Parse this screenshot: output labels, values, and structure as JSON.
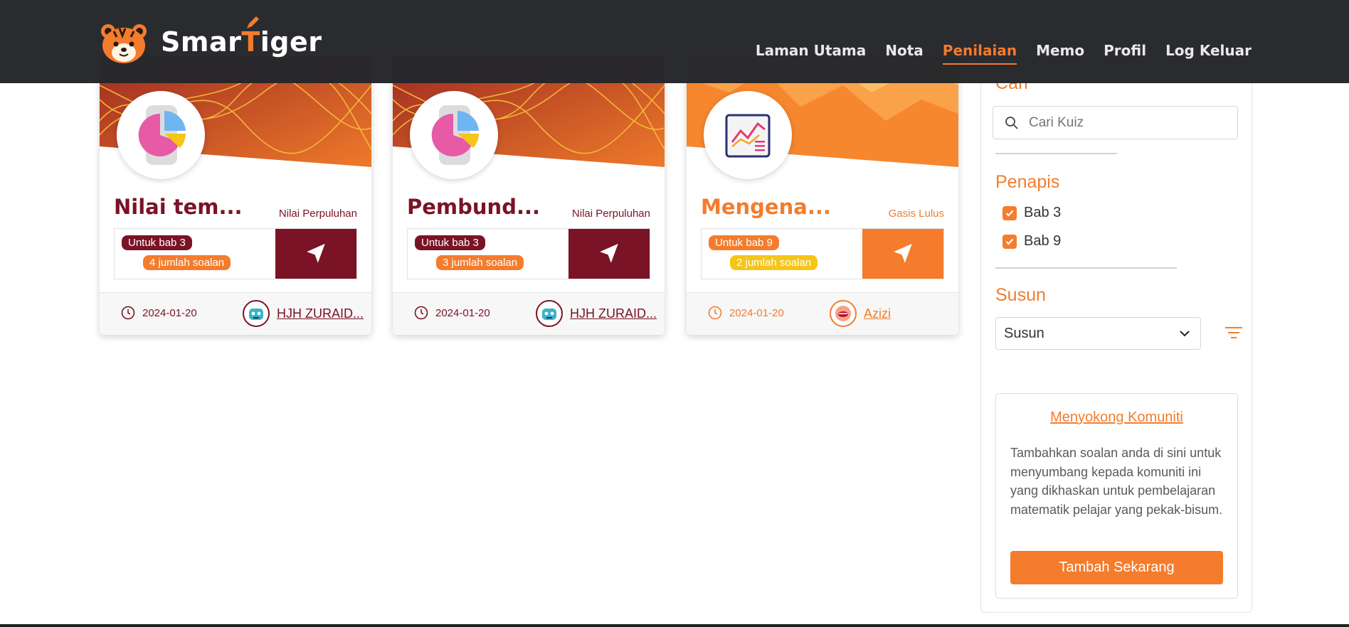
{
  "brand": {
    "name_part1": "Smar",
    "name_t": "T",
    "name_part2": "iger"
  },
  "nav": [
    {
      "label": "Laman Utama",
      "active": false
    },
    {
      "label": "Nota",
      "active": false
    },
    {
      "label": "Penilaian",
      "active": true
    },
    {
      "label": "Memo",
      "active": false
    },
    {
      "label": "Profil",
      "active": false
    },
    {
      "label": "Log Keluar",
      "active": false
    }
  ],
  "cards": [
    {
      "title": "Nilai tem...",
      "type": "Nilai Perpuluhan",
      "chapter": "Untuk bab 3",
      "count": "4 jumlah soalan",
      "date": "2024-01-20",
      "author": "HJH ZURAID...",
      "theme": "maroon",
      "icon": "pie-chart-icon"
    },
    {
      "title": "Pembund...",
      "type": "Nilai Perpuluhan",
      "chapter": "Untuk bab 3",
      "count": "3 jumlah soalan",
      "date": "2024-01-20",
      "author": "HJH ZURAID...",
      "theme": "maroon",
      "icon": "pie-chart-icon"
    },
    {
      "title": "Mengena...",
      "type": "Gasis Lulus",
      "chapter": "Untuk bab 9",
      "count": "2 jumlah soalan",
      "date": "2024-01-20",
      "author": "Azizi",
      "theme": "orange",
      "icon": "line-chart-icon"
    }
  ],
  "sidebar": {
    "search_heading": "Cari",
    "search_placeholder": "Cari Kuiz",
    "filter_heading": "Penapis",
    "filters": [
      {
        "label": "Bab 3",
        "checked": true
      },
      {
        "label": "Bab 9",
        "checked": true
      }
    ],
    "sort_heading": "Susun",
    "sort_value": "Susun",
    "community_link": "Menyokong Komuniti",
    "community_text": "Tambahkan soalan anda di sini untuk menyumbang kepada komuniti ini yang dikhaskan untuk pembelajaran matematik pelajar yang pekak-bisum.",
    "community_button": "Tambah Sekarang"
  },
  "colors": {
    "accent": "#f47c2c",
    "maroon": "#7a1325",
    "navbar": "#26272b",
    "yellow": "#f5c518"
  }
}
